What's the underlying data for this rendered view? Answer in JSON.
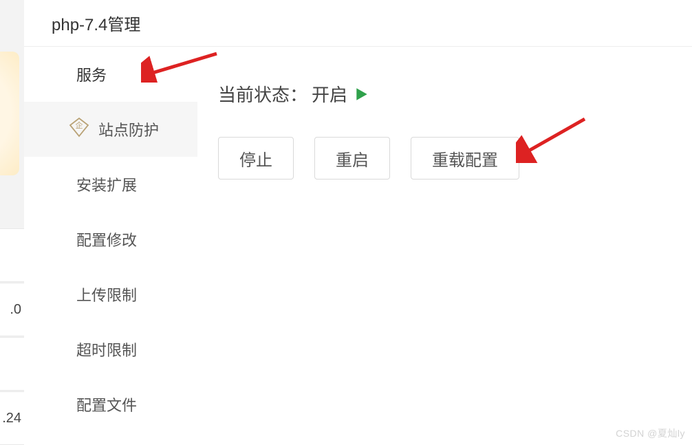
{
  "background": {
    "row_value_1": ".0",
    "row_value_2": ".24"
  },
  "header": {
    "title": "php-7.4管理"
  },
  "sidebar": {
    "items": [
      {
        "label": "服务",
        "has_icon": false,
        "active": true
      },
      {
        "label": "站点防护",
        "has_icon": true,
        "active": false
      },
      {
        "label": "安装扩展",
        "has_icon": false,
        "active": false
      },
      {
        "label": "配置修改",
        "has_icon": false,
        "active": false
      },
      {
        "label": "上传限制",
        "has_icon": false,
        "active": false
      },
      {
        "label": "超时限制",
        "has_icon": false,
        "active": false
      },
      {
        "label": "配置文件",
        "has_icon": false,
        "active": false
      }
    ]
  },
  "content": {
    "status_label": "当前状态：",
    "status_value": "开启",
    "buttons": {
      "stop": "停止",
      "restart": "重启",
      "reload": "重载配置"
    }
  },
  "watermark": "CSDN @夏灿ly"
}
